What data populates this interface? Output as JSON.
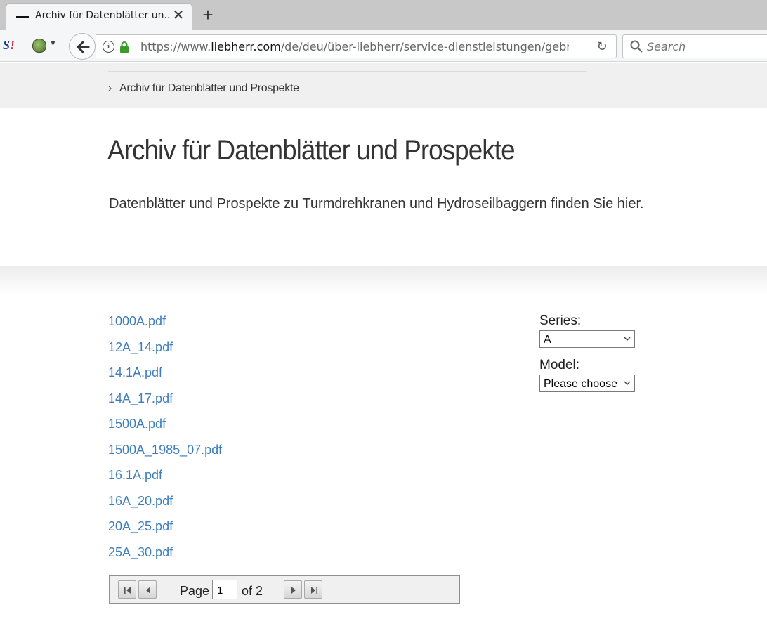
{
  "browser": {
    "tab_title": "Archiv für Datenblätter un...",
    "close_glyph": "✕",
    "newtab_glyph": "+",
    "url_prefix": "https://www.",
    "url_host": "liebherr.com",
    "url_path": "/de/deu/über-liebherr/service-dienstleistungen/gebra",
    "reload_glyph": "↻",
    "search_placeholder": "Search"
  },
  "breadcrumb": {
    "chevron": "›",
    "current": "Archiv für Datenblätter und Prospekte"
  },
  "page": {
    "title": "Archiv für Datenblätter und Prospekte",
    "intro": "Datenblätter und Prospekte zu Turmdrehkranen und Hydroseilbaggern finden Sie hier."
  },
  "files": [
    "1000A.pdf",
    "12A_14.pdf",
    "14.1A.pdf",
    "14A_17.pdf",
    "1500A.pdf",
    "1500A_1985_07.pdf",
    "16.1A.pdf",
    "16A_20.pdf",
    "20A_25.pdf",
    "25A_30.pdf"
  ],
  "filters": {
    "series_label": "Series:",
    "series_value": "A",
    "model_label": "Model:",
    "model_value": "Please choose"
  },
  "pager": {
    "page_label": "Page",
    "current_page": "1",
    "of_label": "of 2"
  },
  "colors": {
    "link": "#3d7dbf",
    "band": "#f0f0f0"
  }
}
